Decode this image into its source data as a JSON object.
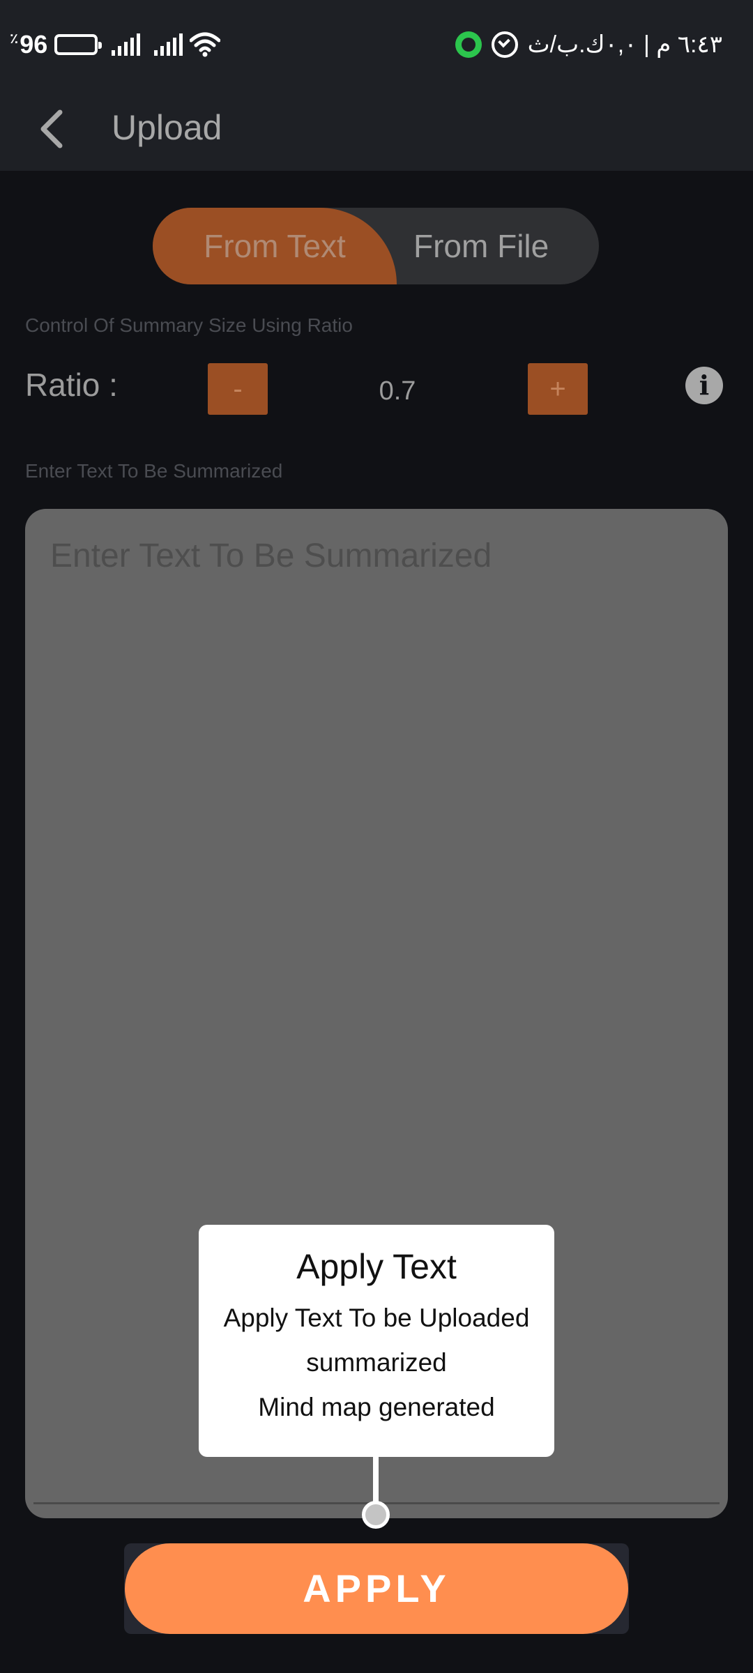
{
  "status_bar": {
    "battery_percent": "96",
    "battery_symbol": "٪",
    "time": "٦:٤٣ م | ٠,٠ك.ب/ث"
  },
  "app_bar": {
    "title": "Upload"
  },
  "toggle": {
    "active": "From Text",
    "from_text": "From Text",
    "from_file": "From File"
  },
  "ratio_section": {
    "label": "Control Of Summary Size Using Ratio",
    "ratio_label": "Ratio :",
    "minus": "-",
    "value": "0.7",
    "plus": "+",
    "info_icon": "i"
  },
  "text_section": {
    "label": "Enter Text To Be Summarized",
    "placeholder": "Enter Text To Be Summarized"
  },
  "tooltip": {
    "title": "Apply Text",
    "line1": "Apply Text To be Uploaded",
    "line2": "summarized",
    "line3": "Mind map generated"
  },
  "apply_button": {
    "label": "APPLY"
  },
  "colors": {
    "accent": "#ff8e4f",
    "toggle_active": "#9b4f24",
    "background": "#101115"
  }
}
